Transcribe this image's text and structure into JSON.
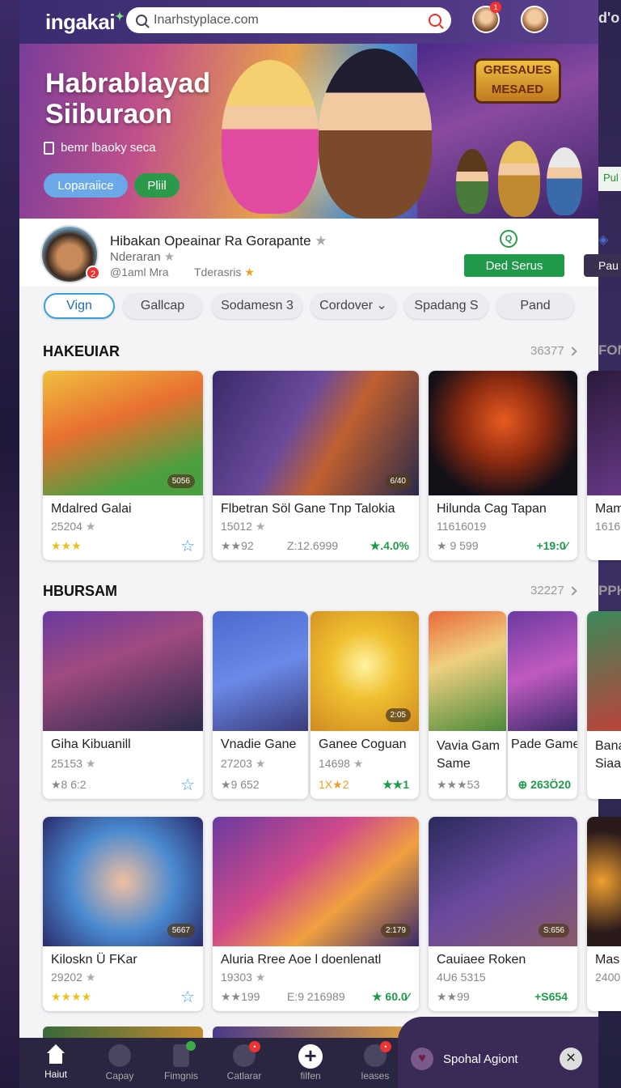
{
  "header": {
    "logo": "ingakai",
    "logo_mark": "✦",
    "search_value": "Inarhstyplace.com",
    "notif_count": "1",
    "edge_text": "d'o"
  },
  "hero": {
    "title": "Habrablayad Siiburaon",
    "subtitle": "bemr lbaoky seca",
    "sign_text": "GRESAUES MESAED",
    "btn_primary": "Loparaiice",
    "btn_secondary": "Pliil"
  },
  "profile": {
    "name": "Hibakan Opeainar Ra Gorapante",
    "sub": "Nderaran",
    "meta1": "@1aml Mra",
    "meta2": "Tderasris",
    "badge": "2",
    "chat_icon": "Q",
    "action_btn": "Ded Serus",
    "edge_btn": "Pau",
    "edge_pu": "Pul"
  },
  "chips": [
    "Vign",
    "Gallcap",
    "Sodamesn 3",
    "Cordover",
    "Spadang S",
    "Pand"
  ],
  "sections": [
    {
      "title": "HAKEUIAR",
      "count": "36377",
      "edge": "FON",
      "cards": [
        {
          "title": "Mdalred Galai",
          "sub": "25204",
          "size": "5056",
          "foot": "★★★",
          "right": "☆"
        },
        {
          "title": "Flbetran Söl Gane Tnp Talokia",
          "sub": "15012",
          "size": "6/40",
          "foot": "★★92",
          "mid": "Z:12.6999",
          "right": "★.4.0%"
        },
        {
          "title": "Hilunda Cag Tapan",
          "sub": "11616019",
          "foot": "★ 9 599",
          "right": "+19:0⁄"
        },
        {
          "title": "Mam",
          "sub": "1616"
        }
      ]
    },
    {
      "title": "HBURSAM",
      "count": "32227",
      "edge": "PPK",
      "cards": [
        {
          "title": "Giha Kibuanill",
          "sub": "25153",
          "foot": "★8 6:2",
          "right": "☆"
        },
        {
          "title": "Vnadie Gane",
          "sub": "27203",
          "foot": "★9 652"
        },
        {
          "title": "Ganee Coguan",
          "sub": "14698",
          "size": "2:05",
          "foot": "1X★2",
          "right": "★★1"
        },
        {
          "title": "Vavia Gam Same",
          "sub": "",
          "foot": "★★★53"
        },
        {
          "title": "Pade Game",
          "sub": "",
          "right": "⊕ 263Ö20"
        },
        {
          "title": "Bana Siaa",
          "sub": ""
        }
      ]
    },
    {
      "cards": [
        {
          "title": "Kiloskn Ü FKar",
          "sub": "29202",
          "size": "5667",
          "foot": "★★★★",
          "right": "☆"
        },
        {
          "title": "Aluria Rree Aoe l doenlenatl",
          "sub": "19303",
          "size": "2:179",
          "foot": "★★199",
          "mid": "E:9 216989",
          "right": "★ 60.0⁄"
        },
        {
          "title": "Cauiaee Roken",
          "sub": "4U6 5315",
          "size": "S:656",
          "foot": "★★99",
          "right": "+S654"
        },
        {
          "title": "Mas",
          "sub": "2400"
        }
      ]
    }
  ],
  "nav": [
    {
      "label": "Haiut",
      "icon": "home-icon"
    },
    {
      "label": "Capay",
      "icon": "chat-icon"
    },
    {
      "label": "Fimgnis",
      "icon": "device-icon"
    },
    {
      "label": "Catlarar",
      "icon": "camera-icon"
    },
    {
      "label": "filfen",
      "icon": "plus-icon"
    },
    {
      "label": "leases",
      "icon": "user-icon"
    }
  ],
  "support": {
    "label": "Spohal Agiont",
    "close": "✕"
  },
  "colors": {
    "accent": "#1f9a4a",
    "brand": "#3a2c70",
    "link": "#3aa0d8"
  }
}
